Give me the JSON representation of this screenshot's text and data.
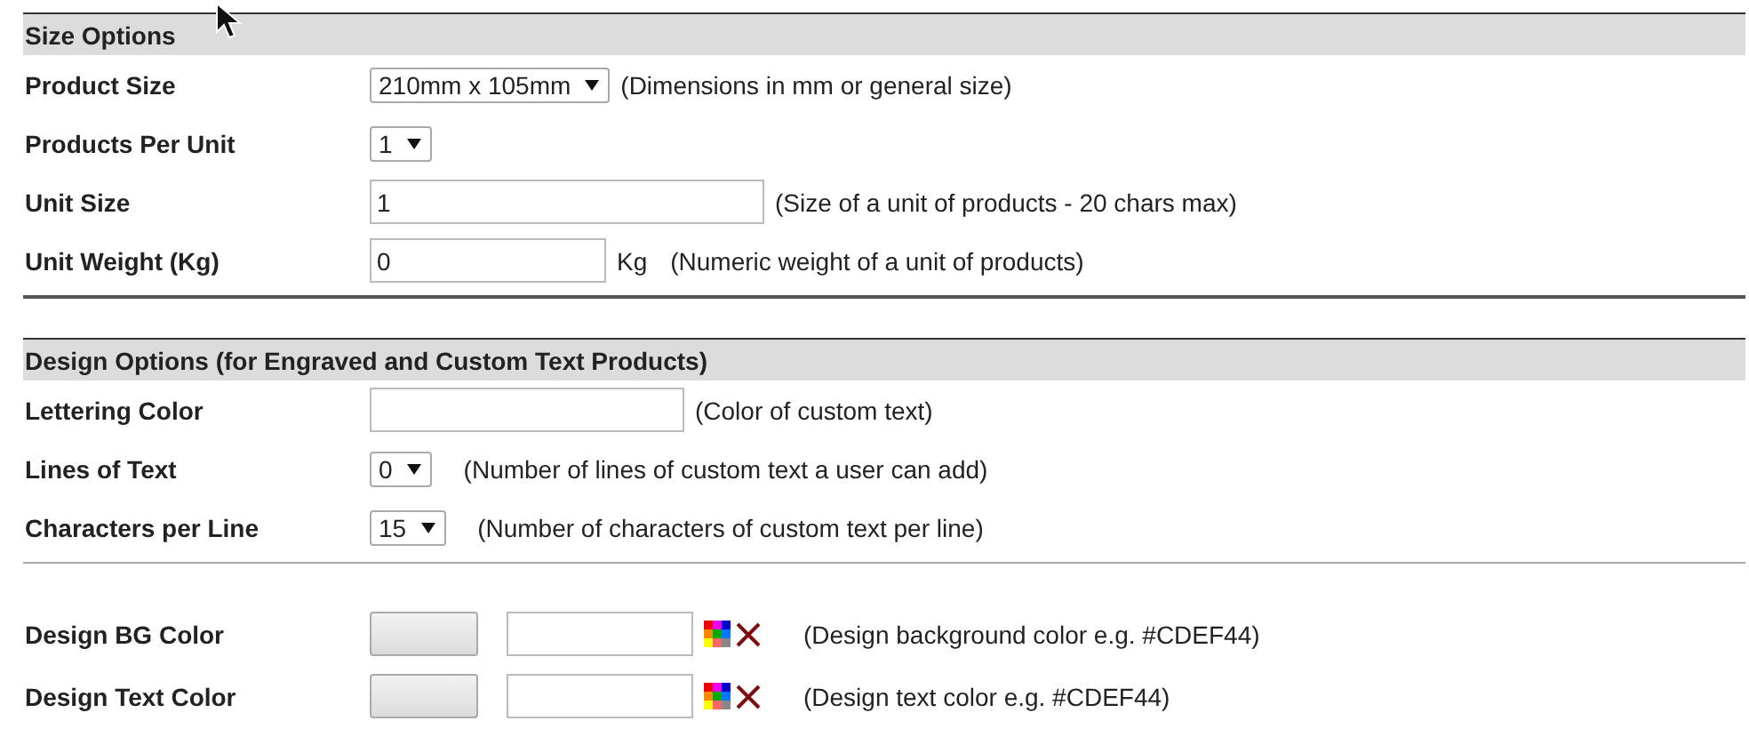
{
  "sections": [
    {
      "title": "Size Options",
      "rows": [
        {
          "kind": "select",
          "label": "Product Size",
          "value": "210mm x 105mm",
          "hint": "(Dimensions in mm or general size)"
        },
        {
          "kind": "select",
          "label": "Products Per Unit",
          "value": "1"
        },
        {
          "kind": "text",
          "label": "Unit Size",
          "value": "1",
          "hint": "(Size of a unit of products - 20 chars max)"
        },
        {
          "kind": "text",
          "label": "Unit Weight (Kg)",
          "value": "0",
          "unit": "Kg",
          "hint": "(Numeric weight of a unit of products)"
        }
      ]
    },
    {
      "title": "Design Options (for Engraved and Custom Text Products)",
      "rows": [
        {
          "kind": "text",
          "label": "Lettering Color",
          "hint": "(Color of custom text)"
        },
        {
          "kind": "select",
          "label": "Lines of Text",
          "value": "0",
          "hint": "(Number of lines of custom text a user can add)"
        },
        {
          "kind": "select",
          "label": "Characters per Line",
          "value": "15",
          "hint": "(Number of characters of custom text per line)"
        }
      ]
    },
    {
      "rows": [
        {
          "kind": "color",
          "label": "Design BG Color",
          "hint": "(Design background color e.g. #CDEF44)"
        },
        {
          "kind": "color",
          "label": "Design Text Color",
          "hint": "(Design text color e.g. #CDEF44)"
        }
      ]
    }
  ]
}
